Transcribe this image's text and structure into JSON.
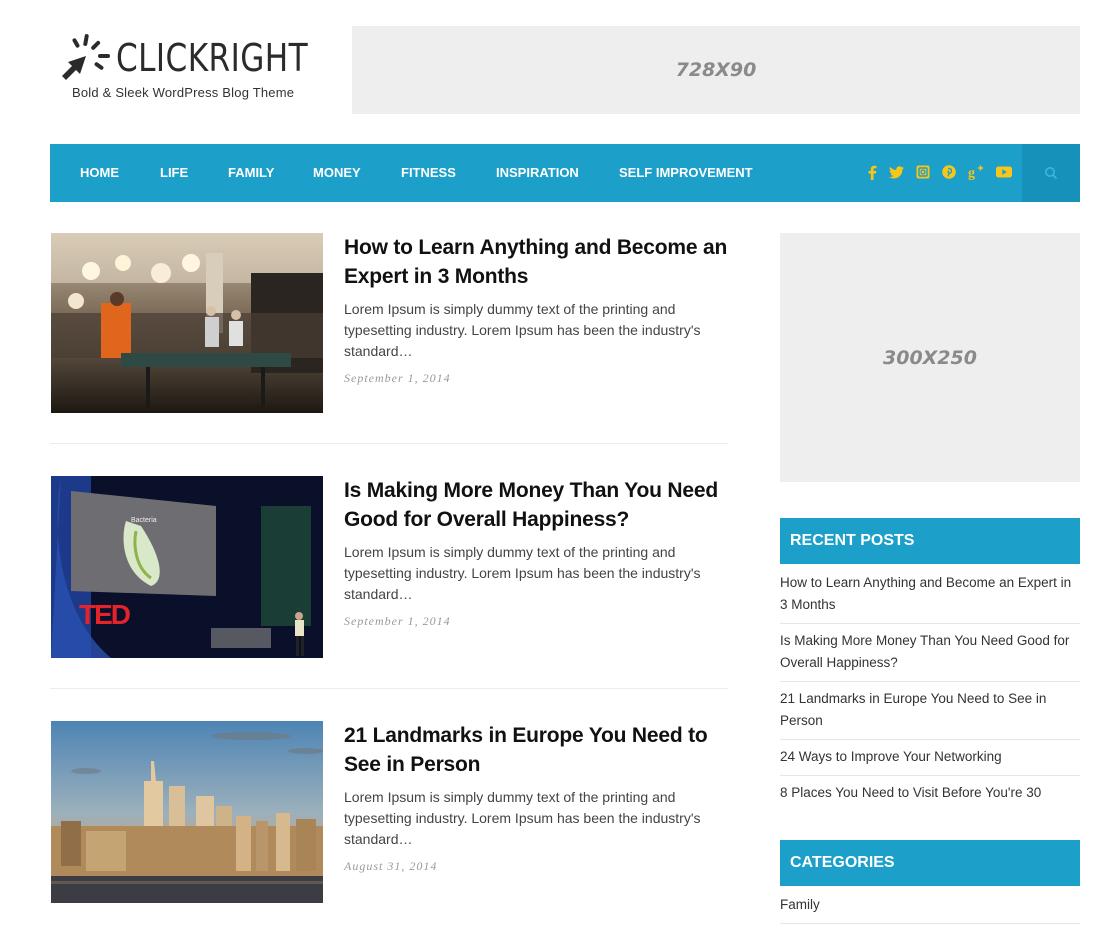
{
  "header": {
    "logo_text": "CLICKRIGHT",
    "tagline": "Bold & Sleek WordPress Blog Theme",
    "ad_top_label": "728X90"
  },
  "nav": {
    "items": [
      {
        "label": "Home"
      },
      {
        "label": "Life"
      },
      {
        "label": "Family"
      },
      {
        "label": "Money"
      },
      {
        "label": "Fitness"
      },
      {
        "label": "Inspiration"
      },
      {
        "label": "Self Improvement"
      }
    ],
    "social": [
      {
        "icon": "facebook-icon",
        "glyph": "f"
      },
      {
        "icon": "twitter-icon",
        "glyph": "t"
      },
      {
        "icon": "instagram-icon",
        "glyph": "◘"
      },
      {
        "icon": "pinterest-icon",
        "glyph": "p"
      },
      {
        "icon": "google-plus-icon",
        "glyph": "g+"
      },
      {
        "icon": "youtube-icon",
        "glyph": "▶"
      }
    ],
    "search_icon": "search-icon"
  },
  "colors": {
    "primary": "#1c9fc8",
    "primary_dark": "#1692ba",
    "social_icon": "#f6c61a",
    "ad_bg": "#eeeeee"
  },
  "posts": [
    {
      "title": "How to Learn Anything and Become an Expert in 3 Months",
      "excerpt": "Lorem Ipsum is simply dummy text of the printing and typesetting industry. Lorem Ipsum has been the industry's standard…",
      "date": "September 1, 2014",
      "image": "office ping-pong game photo"
    },
    {
      "title": "Is Making More Money Than You Need Good for Overall Happiness?",
      "excerpt": "Lorem Ipsum is simply dummy text of the printing and typesetting industry. Lorem Ipsum has been the industry's standard…",
      "date": "September 1, 2014",
      "image": "TED stage talk photo",
      "image_text": "TED",
      "slide_text": "Bacteria"
    },
    {
      "title": "21 Landmarks in Europe You Need to See in Person",
      "excerpt": "Lorem Ipsum is simply dummy text of the printing and typesetting industry. Lorem Ipsum has been the industry's standard…",
      "date": "August 31, 2014",
      "image": "city skyline at sunset photo"
    }
  ],
  "sidebar": {
    "ad_label": "300X250",
    "recent_posts": {
      "title": "Recent Posts",
      "items": [
        "How to Learn Anything and Become an Expert in 3 Months",
        "Is Making More Money Than You Need Good for Overall Happiness?",
        "21 Landmarks in Europe You Need to See in Person",
        "24 Ways to Improve Your Networking",
        "8 Places You Need to Visit Before You're 30"
      ]
    },
    "categories": {
      "title": "Categories",
      "items": [
        "Family"
      ]
    }
  }
}
